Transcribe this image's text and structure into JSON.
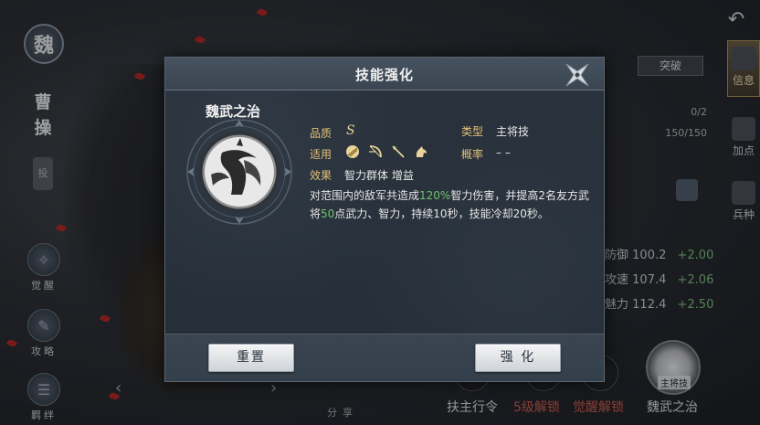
{
  "background": {
    "faction_char": "魏",
    "hero_name": "曹操",
    "hero_side_tag": "投",
    "left_nav": [
      {
        "label": "觉醒",
        "icon": "awaken-icon"
      },
      {
        "label": "攻略",
        "icon": "scroll-icon"
      },
      {
        "label": "羁绊",
        "icon": "bond-icon"
      }
    ],
    "right_tabs": [
      {
        "label": "信息",
        "active": true
      },
      {
        "label": "加点",
        "active": false
      },
      {
        "label": "兵种",
        "active": false
      }
    ],
    "breakthrough_label": "突破",
    "progress_text_1": "0/2",
    "progress_text_2": "150/150",
    "stats": [
      {
        "name": "防御",
        "value": "100.2",
        "inc": "+2.00"
      },
      {
        "name": "攻速",
        "value": "107.4",
        "inc": "+2.06"
      },
      {
        "name": "魅力",
        "value": "112.4",
        "inc": "+2.50"
      }
    ],
    "bottom": {
      "item1": "扶主行令",
      "item2": "5级解锁",
      "item3": "觉醒解锁",
      "item4": "魏武之治",
      "skill_thumb_tag": "主将技",
      "share": "分享"
    }
  },
  "modal": {
    "title": "技能强化",
    "skill_name": "魏武之治",
    "grade_label": "品质",
    "grade_value": "S",
    "type_label": "类型",
    "type_value": "主将技",
    "applies_label": "适用",
    "applies_icons": [
      "shield-icon",
      "bow-icon",
      "spear-icon",
      "cavalry-icon"
    ],
    "rate_label": "概率",
    "rate_value": "– –",
    "effect_label": "效果",
    "effect_value": "智力群体  增益",
    "description": {
      "p1": "对范围内的敌军共造成",
      "hl1": "120%",
      "p2": "智力伤害，并提高2名友方武将",
      "hl2": "50",
      "p3": "点武力、智力，持续10秒，技能冷却20秒。"
    },
    "reset_button": "重置",
    "enhance_button": "强 化"
  }
}
